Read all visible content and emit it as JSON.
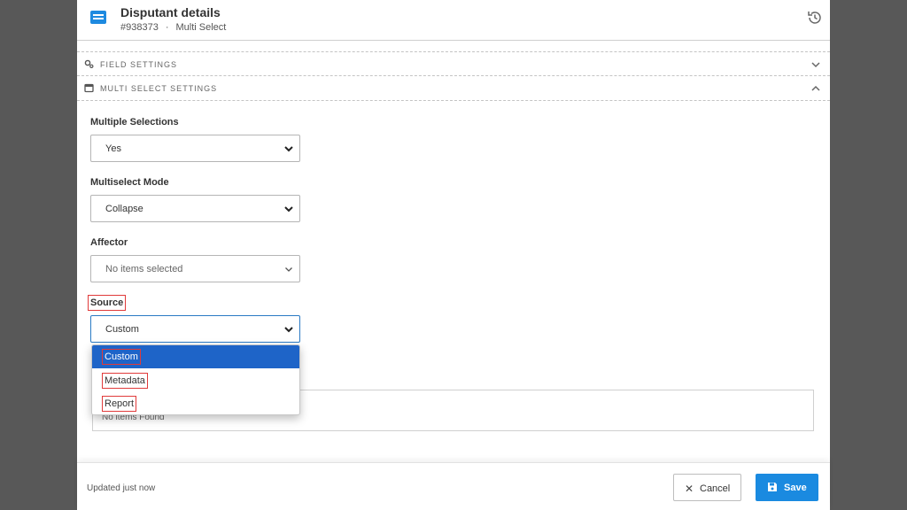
{
  "header": {
    "title": "Disputant details",
    "id": "#938373",
    "separator": "·",
    "type": "Multi Select"
  },
  "sections": [
    {
      "label": "FIELD SETTINGS",
      "state": "collapsed"
    },
    {
      "label": "MULTI SELECT SETTINGS",
      "state": "expanded"
    }
  ],
  "fields": {
    "multiple_selections": {
      "label": "Multiple Selections",
      "value": "Yes"
    },
    "multiselect_mode": {
      "label": "Multiselect Mode",
      "value": "Collapse"
    },
    "affector": {
      "label": "Affector",
      "value": "No items selected"
    },
    "source": {
      "label": "Source",
      "value": "Custom"
    }
  },
  "source_dropdown": {
    "options": [
      "Custom",
      "Metadata",
      "Report"
    ],
    "selected": "Custom"
  },
  "empty_list": {
    "text": "No items Found"
  },
  "footer": {
    "status": "Updated just now",
    "cancel_label": "Cancel",
    "save_label": "Save"
  },
  "colors": {
    "accent": "#1a8ae0",
    "selected_option": "#1e64c8",
    "highlight_box": "#e03a3a"
  }
}
